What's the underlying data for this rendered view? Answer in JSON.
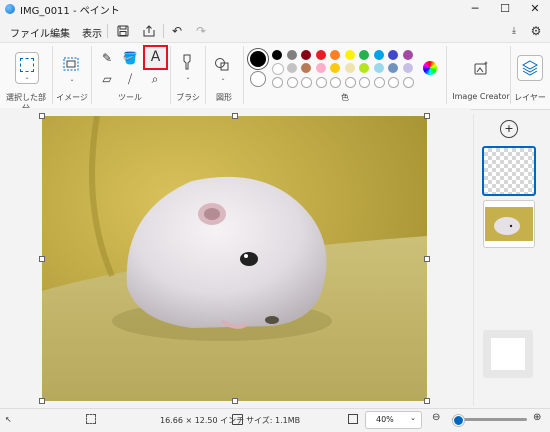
{
  "window": {
    "title": "IMG_0011 - ペイント",
    "minimize": "─",
    "maximize": "☐",
    "close": "✕"
  },
  "menu": {
    "items": [
      "ファイル",
      "編集",
      "表示"
    ]
  },
  "ribbon": {
    "groups": {
      "selection": "選択した部分",
      "image": "イメージ",
      "tools": "ツール",
      "brushes": "ブラシ",
      "shapes": "図形",
      "colors": "色",
      "image_creator": "Image Creator",
      "layers": "レイヤー"
    },
    "text_tool_label": "A",
    "palette_row1": [
      "#000000",
      "#7f7f7f",
      "#880015",
      "#ed1c24",
      "#ff7f27",
      "#fff200",
      "#22b14c",
      "#00a2e8",
      "#3f48cc",
      "#a349a4"
    ],
    "palette_row2": [
      "#ffffff",
      "#c3c3c3",
      "#b97a57",
      "#ffaec9",
      "#ffc90e",
      "#efe4b0",
      "#b5e61d",
      "#99d9ea",
      "#7092be",
      "#c8bfe7"
    ]
  },
  "layers": {
    "add": "+"
  },
  "status": {
    "dimensions": "16.66 × 12.50 インチ",
    "size": "サイズ: 1.1MB",
    "zoom": "40%",
    "zoom_level": 0.4
  },
  "colors": {
    "accent": "#0067c0",
    "highlight": "#e81123",
    "image_bg": "#c9b44a",
    "hamster": "#e8e4e6"
  }
}
